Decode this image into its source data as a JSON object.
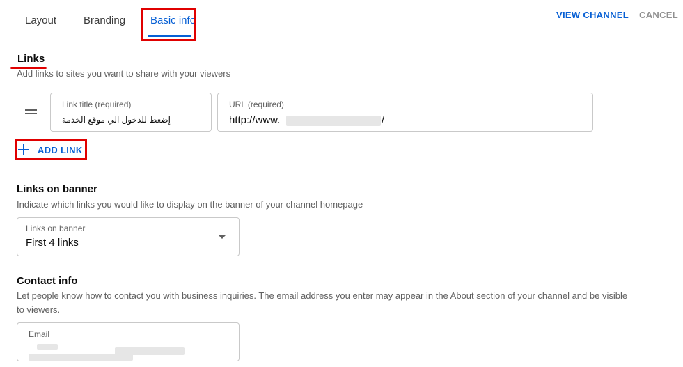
{
  "tabs": [
    {
      "label": "Layout"
    },
    {
      "label": "Branding"
    },
    {
      "label": "Basic info",
      "active": true
    }
  ],
  "header_actions": {
    "view_channel": "VIEW CHANNEL",
    "cancel": "CANCEL"
  },
  "links_section": {
    "title": "Links",
    "description": "Add links to sites you want to share with your viewers",
    "link_rows": [
      {
        "title_label": "Link title (required)",
        "title_value": "إضغط للدخول الي موقع الخدمة",
        "url_label": "URL (required)",
        "url_prefix": "http://www.",
        "url_suffix": "/"
      }
    ],
    "add_link_label": "ADD LINK"
  },
  "banner_section": {
    "title": "Links on banner",
    "description": "Indicate which links you would like to display on the banner of your channel homepage",
    "select_label": "Links on banner",
    "select_value": "First 4 links"
  },
  "contact_section": {
    "title": "Contact info",
    "description_line1": "Let people know how to contact you with business inquiries. The email address you enter may appear in the About section of your channel and be visible",
    "description_line2": "to viewers.",
    "email_label": "Email"
  },
  "colors": {
    "accent": "#065fd4",
    "annotation": "#e00000",
    "muted": "#606060"
  },
  "icons": [
    "drag-handle-icon",
    "plus-icon",
    "dropdown-caret-icon"
  ]
}
